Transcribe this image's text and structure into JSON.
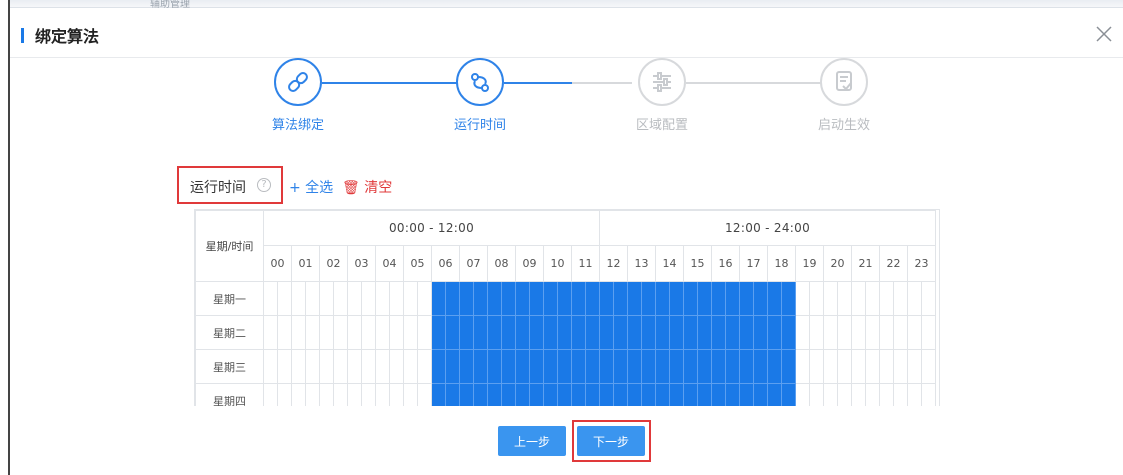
{
  "header": {
    "title": "绑定算法"
  },
  "top_strip": {
    "text": "辅助管理"
  },
  "steps": [
    {
      "label": "算法绑定",
      "icon": "link-icon",
      "state": "active"
    },
    {
      "label": "运行时间",
      "icon": "route-icon",
      "state": "active"
    },
    {
      "label": "区域配置",
      "icon": "sliders-icon",
      "state": "inactive"
    },
    {
      "label": "启动生效",
      "icon": "document-icon",
      "state": "inactive"
    }
  ],
  "schedule": {
    "label": "运行时间",
    "help": "?",
    "select_all": "+ 全选",
    "clear": "清空",
    "corner": "星期/时间",
    "periods": [
      "00:00 - 12:00",
      "12:00 - 24:00"
    ],
    "hours": [
      "00",
      "01",
      "02",
      "03",
      "04",
      "05",
      "06",
      "07",
      "08",
      "09",
      "10",
      "11",
      "12",
      "13",
      "14",
      "15",
      "16",
      "17",
      "18",
      "19",
      "20",
      "21",
      "22",
      "23"
    ],
    "days": [
      "星期一",
      "星期二",
      "星期三",
      "星期四"
    ],
    "selected_range": {
      "from": "06:00",
      "to": "19:00"
    }
  },
  "buttons": {
    "prev": "上一步",
    "next": "下一步"
  },
  "colors": {
    "accent": "#2f83e8",
    "selected": "#1a79e7",
    "highlight": "#e0393a",
    "inactive": "#d7d9dc"
  }
}
